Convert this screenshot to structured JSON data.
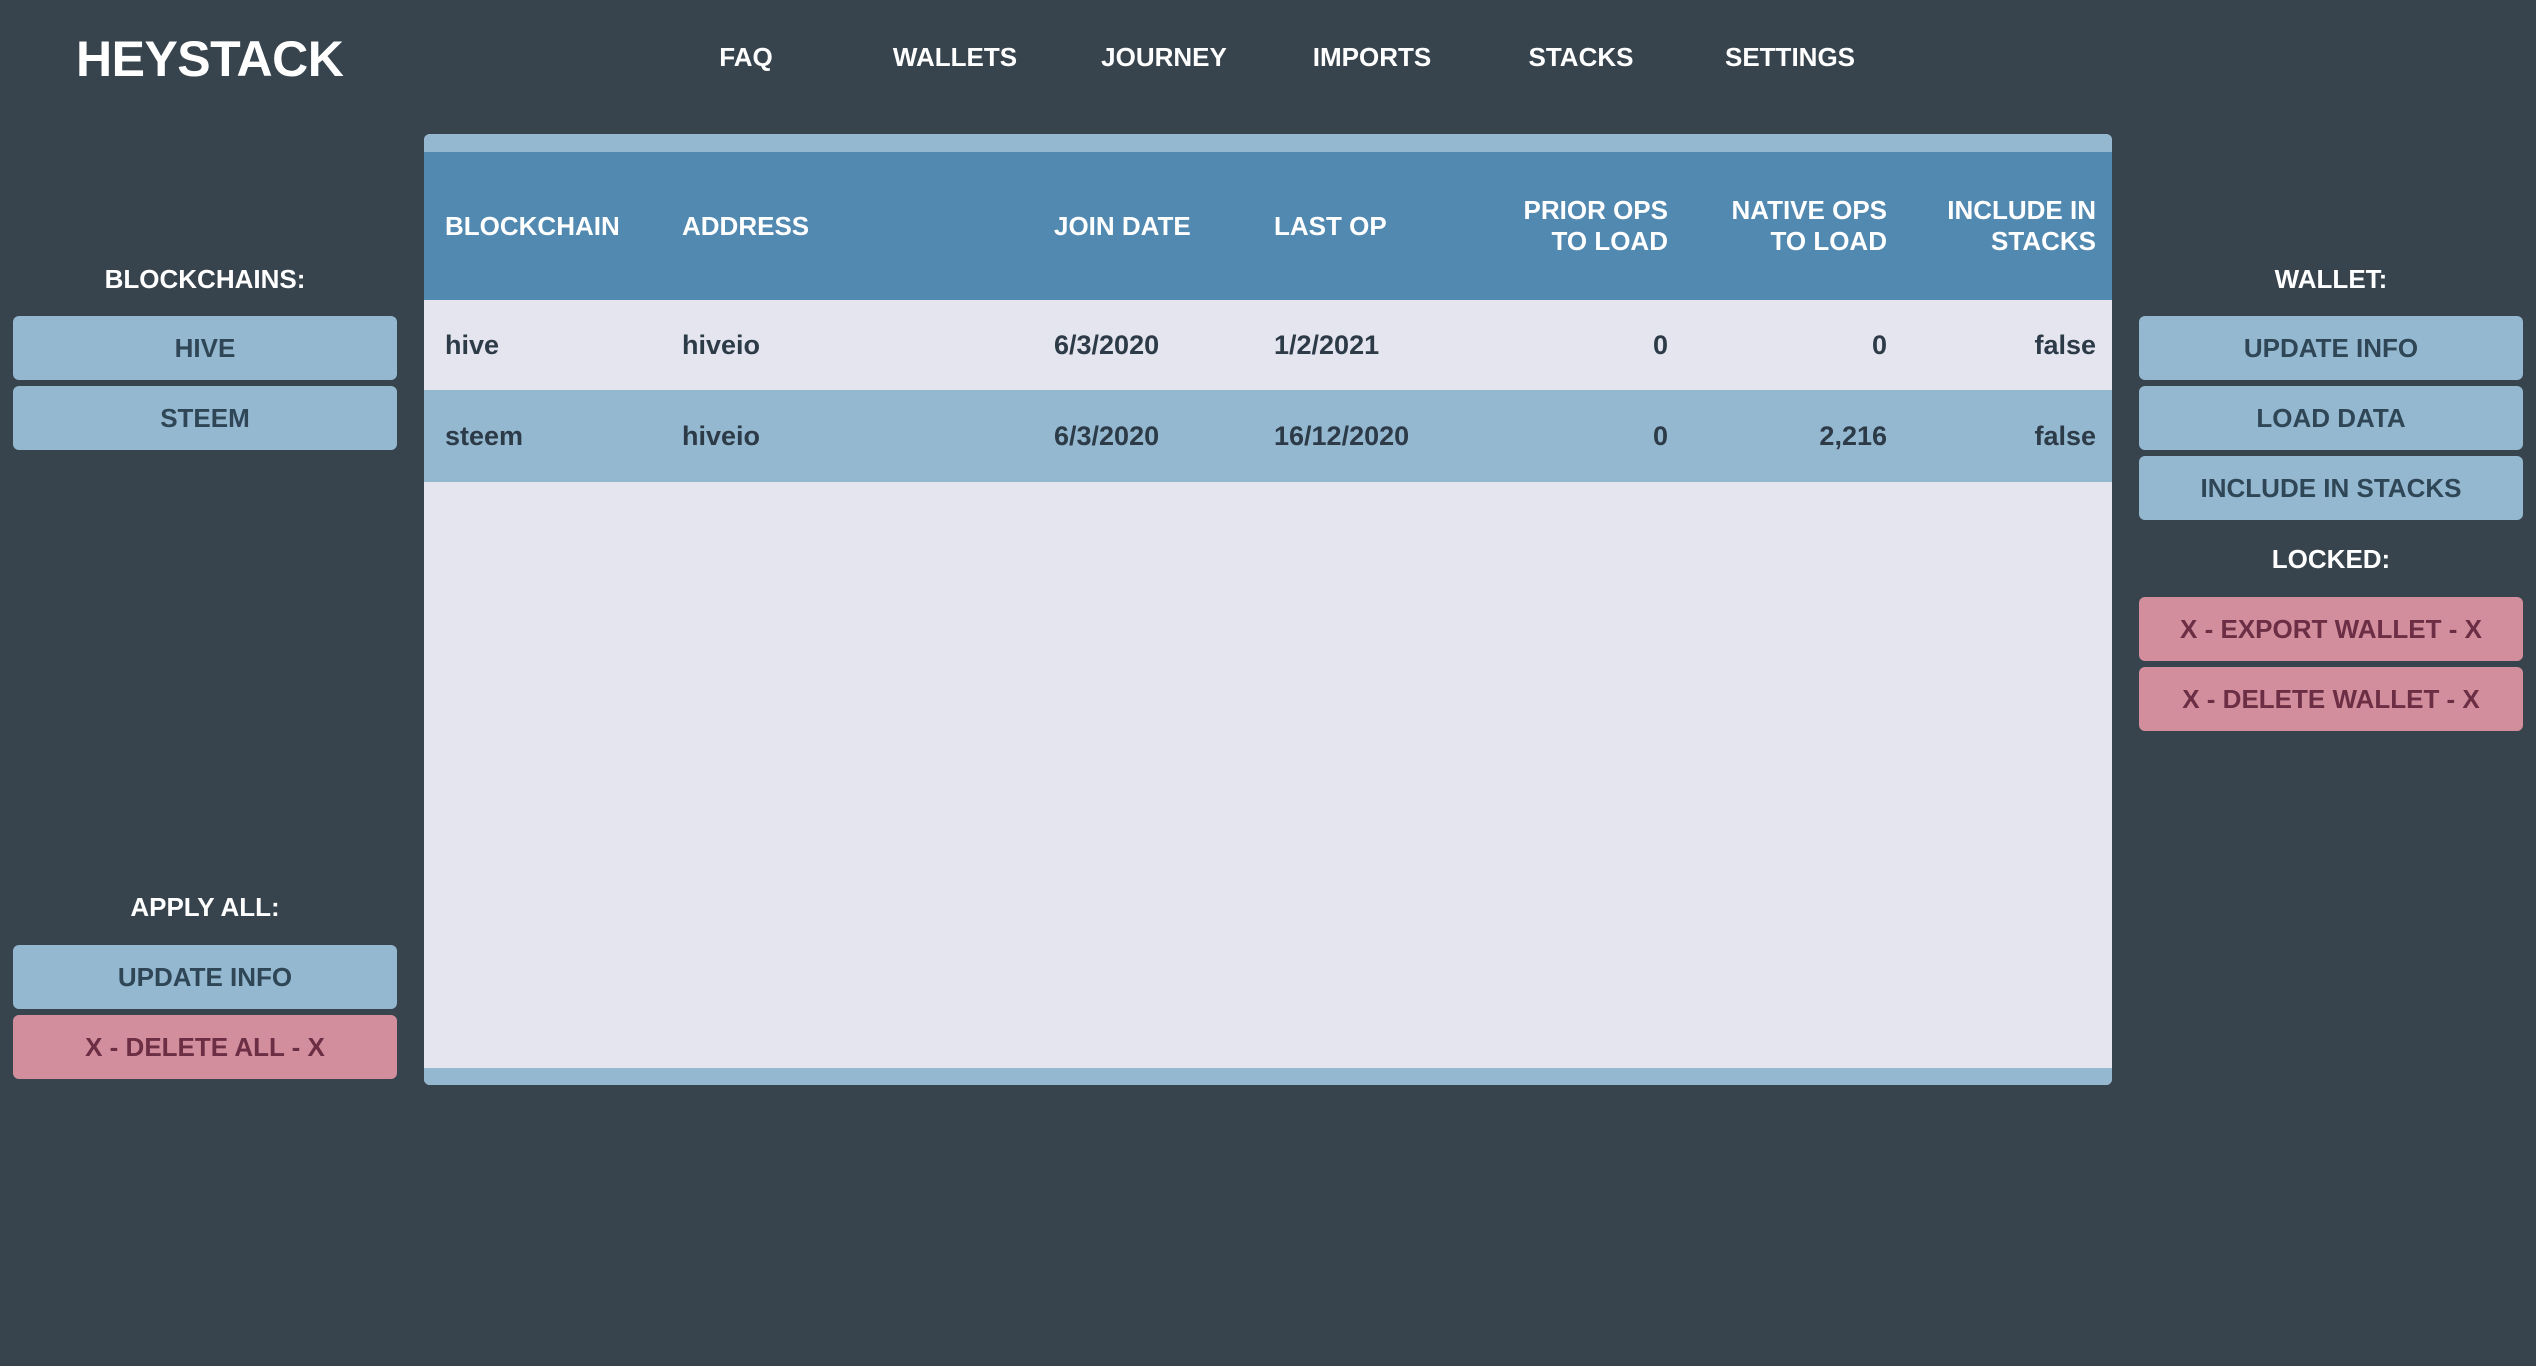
{
  "app": {
    "logo": "HEYSTACK"
  },
  "nav": [
    {
      "label": "FAQ"
    },
    {
      "label": "WALLETS"
    },
    {
      "label": "JOURNEY"
    },
    {
      "label": "IMPORTS"
    },
    {
      "label": "STACKS"
    },
    {
      "label": "SETTINGS"
    }
  ],
  "left_sidebar": {
    "blockchains_label": "BLOCKCHAINS:",
    "blockchains": [
      {
        "label": "HIVE"
      },
      {
        "label": "STEEM"
      }
    ],
    "apply_all_label": "APPLY ALL:",
    "update_info_label": "UPDATE INFO",
    "delete_all_label": "X - DELETE ALL - X"
  },
  "right_sidebar": {
    "wallet_label": "WALLET:",
    "update_info_label": "UPDATE INFO",
    "load_data_label": "LOAD DATA",
    "include_in_stacks_label": "INCLUDE IN STACKS",
    "locked_label": "LOCKED:",
    "export_wallet_label": "X - EXPORT WALLET - X",
    "delete_wallet_label": "X - DELETE WALLET - X"
  },
  "table": {
    "headers": {
      "blockchain": "BLOCKCHAIN",
      "address": "ADDRESS",
      "join_date": "JOIN DATE",
      "last_op": "LAST OP",
      "prior_ops_1": "PRIOR OPS",
      "prior_ops_2": "TO LOAD",
      "native_ops_1": "NATIVE OPS",
      "native_ops_2": "TO LOAD",
      "include_1": "INCLUDE IN",
      "include_2": "STACKS"
    },
    "rows": [
      {
        "blockchain": "hive",
        "address": "hiveio",
        "join_date": "6/3/2020",
        "last_op": "1/2/2021",
        "prior_ops": "0",
        "native_ops": "0",
        "include": "false"
      },
      {
        "blockchain": "steem",
        "address": "hiveio",
        "join_date": "6/3/2020",
        "last_op": "16/12/2020",
        "prior_ops": "0",
        "native_ops": "2,216",
        "include": "false"
      }
    ]
  },
  "colors": {
    "background": "#37444e",
    "header_blue": "#5189b1",
    "light_blue": "#94b8d0",
    "panel_bg": "#e5e5ef",
    "danger_pink": "#d38e9d"
  }
}
